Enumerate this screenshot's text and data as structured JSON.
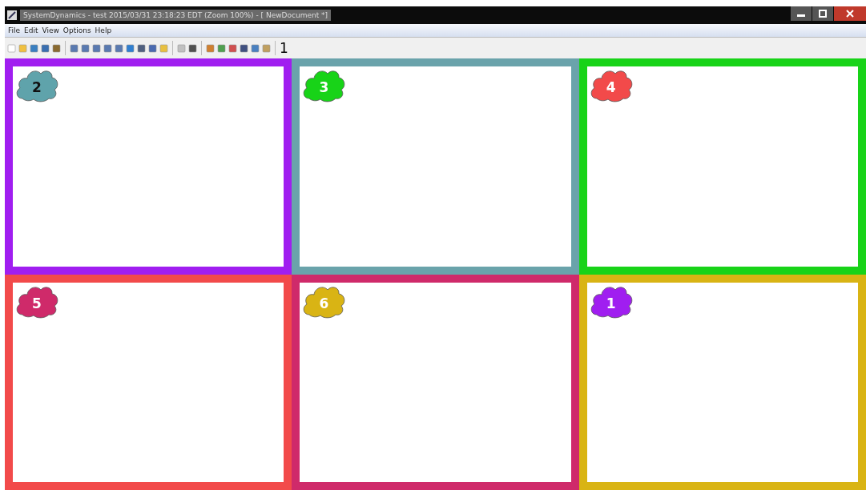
{
  "window": {
    "title": "SystemDynamics - test 2015/03/31 23:18:23 EDT (Zoom 100%) - [ NewDocument *]"
  },
  "menu": [
    "File",
    "Edit",
    "View",
    "Options",
    "Help"
  ],
  "toolbar": {
    "page_number": "1"
  },
  "panels": [
    {
      "color": "#a01ef0",
      "cloud": {
        "label": "2",
        "color": "#5fa3ab",
        "dark_label": true
      }
    },
    {
      "color": "#6aa3ab",
      "cloud": {
        "label": "3",
        "color": "#18d318",
        "dark_label": false
      }
    },
    {
      "color": "#18d318",
      "cloud": {
        "label": "4",
        "color": "#f24a4a",
        "dark_label": false
      }
    },
    {
      "color": "#f24a4a",
      "cloud": {
        "label": "5",
        "color": "#cf2a6a",
        "dark_label": false
      }
    },
    {
      "color": "#cf2a6a",
      "cloud": {
        "label": "6",
        "color": "#d9b414",
        "dark_label": false
      }
    },
    {
      "color": "#d9b414",
      "cloud": {
        "label": "1",
        "color": "#a01ef0",
        "dark_label": false
      }
    }
  ]
}
